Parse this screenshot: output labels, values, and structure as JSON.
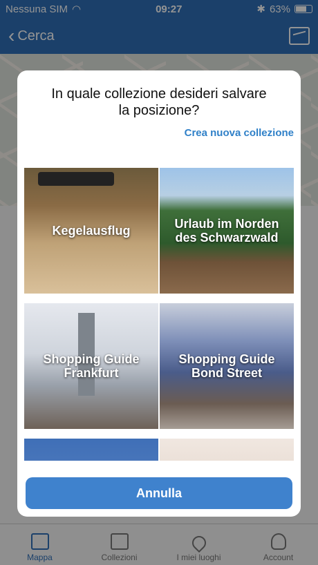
{
  "status": {
    "carrier": "Nessuna SIM",
    "time": "09:27",
    "battery": "63%"
  },
  "nav": {
    "back_label": "Cerca"
  },
  "tabs": [
    {
      "label": "Mappa"
    },
    {
      "label": "Collezioni"
    },
    {
      "label": "I miei luoghi"
    },
    {
      "label": "Account"
    }
  ],
  "dialog": {
    "title": "In quale collezione desideri salvare la posizione?",
    "create_link": "Crea nuova collezione",
    "collections": [
      {
        "label": "Kegelausflug"
      },
      {
        "label": "Urlaub im Norden des Schwarzwald"
      },
      {
        "label": "Shopping Guide Frankfurt"
      },
      {
        "label": "Shopping Guide Bond Street"
      },
      {
        "label": ""
      },
      {
        "label": ""
      }
    ],
    "cancel_label": "Annulla"
  },
  "colors": {
    "accent": "#2f6fb7",
    "button": "#3f82cd",
    "link": "#2f80c8"
  }
}
